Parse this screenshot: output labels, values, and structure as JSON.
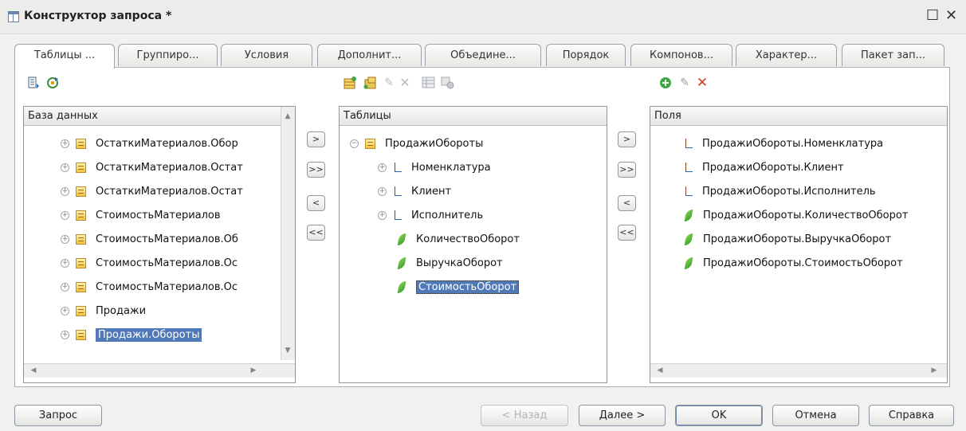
{
  "window": {
    "title": "Конструктор запроса *",
    "maximize_glyph": "☐",
    "close_glyph": "✕"
  },
  "tabs": [
    {
      "label": "Таблицы ..."
    },
    {
      "label": "Группиро..."
    },
    {
      "label": "Условия"
    },
    {
      "label": "Дополнит..."
    },
    {
      "label": "Объедине..."
    },
    {
      "label": "Порядок"
    },
    {
      "label": "Компонов..."
    },
    {
      "label": "Характер..."
    },
    {
      "label": "Пакет зап..."
    }
  ],
  "database_panel": {
    "header": "База данных",
    "items": [
      {
        "label": "ОстаткиМатериалов.Обор"
      },
      {
        "label": "ОстаткиМатериалов.Остат"
      },
      {
        "label": "ОстаткиМатериалов.Остат"
      },
      {
        "label": "СтоимостьМатериалов"
      },
      {
        "label": "СтоимостьМатериалов.Об"
      },
      {
        "label": "СтоимостьМатериалов.Ос"
      },
      {
        "label": "СтоимостьМатериалов.Ос"
      },
      {
        "label": "Продажи"
      },
      {
        "label": "Продажи.Обороты",
        "selected": true
      }
    ]
  },
  "tables_panel": {
    "header": "Таблицы",
    "root": {
      "label": "ПродажиОбороты"
    },
    "children": [
      {
        "label": "Номенклатура",
        "kind": "dimension"
      },
      {
        "label": "Клиент",
        "kind": "dimension"
      },
      {
        "label": "Исполнитель",
        "kind": "dimension"
      },
      {
        "label": "КоличествоОборот",
        "kind": "resource"
      },
      {
        "label": "ВыручкаОборот",
        "kind": "resource"
      },
      {
        "label": "СтоимостьОборот",
        "kind": "resource",
        "selected": true
      }
    ]
  },
  "fields_panel": {
    "header": "Поля",
    "items": [
      {
        "label": "ПродажиОбороты.Номенклатура",
        "kind": "dimension"
      },
      {
        "label": "ПродажиОбороты.Клиент",
        "kind": "dimension"
      },
      {
        "label": "ПродажиОбороты.Исполнитель",
        "kind": "dimension"
      },
      {
        "label": "ПродажиОбороты.КоличествоОборот",
        "kind": "resource"
      },
      {
        "label": "ПродажиОбороты.ВыручкаОборот",
        "kind": "resource"
      },
      {
        "label": "ПродажиОбороты.СтоимостьОборот",
        "kind": "resource"
      }
    ]
  },
  "move_buttons": {
    "add": ">",
    "add_all": ">>",
    "remove": "<",
    "remove_all": "<<"
  },
  "bottom_buttons": {
    "query": "Запрос",
    "back": "< Назад",
    "next": "Далее >",
    "ok": "OK",
    "cancel": "Отмена",
    "help": "Справка"
  },
  "icons": {
    "query_icon": "query-icon",
    "table": "table-icon",
    "dimension": "dimension-icon",
    "resource": "resource-icon"
  },
  "colors": {
    "selection": "#4f79b7",
    "window_bg": "#f1f1ef",
    "delete_red": "#d43a2b",
    "add_green": "#3fa845"
  }
}
